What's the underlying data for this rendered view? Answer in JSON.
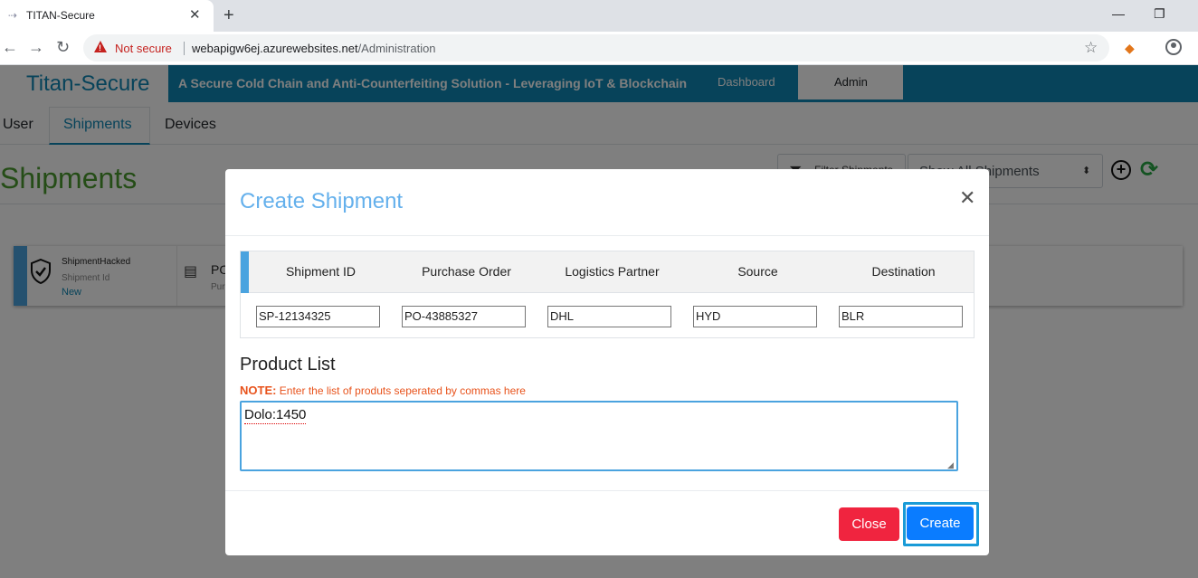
{
  "browser": {
    "tab_title": "TITAN-Secure",
    "security_label": "Not secure",
    "url_host": "webapigw6ej.azurewebsites.net",
    "url_path": "/Administration"
  },
  "app": {
    "brand": "Titan-Secure",
    "tagline": "A Secure Cold Chain and Anti-Counterfeiting Solution - Leveraging IoT & Blockchain",
    "nav": {
      "dashboard": "Dashboard",
      "admin": "Admin"
    },
    "subtabs": {
      "user": "User",
      "shipments": "Shipments",
      "devices": "Devices"
    },
    "page_title": "Shipments",
    "filter_label": "Filter Shipments",
    "show_select": "Show All Shipments",
    "card": {
      "name": "ShipmentHacked",
      "sub_label": "Shipment Id",
      "status": "New",
      "po_label": "PO",
      "po_sub": "Pur"
    }
  },
  "modal": {
    "title": "Create Shipment",
    "columns": [
      "Shipment ID",
      "Purchase Order",
      "Logistics Partner",
      "Source",
      "Destination"
    ],
    "values": [
      "SP-12134325",
      "PO-43885327",
      "DHL",
      "HYD",
      "BLR"
    ],
    "product_list_label": "Product List",
    "note_key": "NOTE:",
    "note_text": "Enter the list of produts seperated by commas here",
    "product_value": "Dolo:1450",
    "close_label": "Close",
    "create_label": "Create"
  },
  "colors": {
    "brand_teal": "#0f87b4",
    "title_green": "#4a9a2e",
    "modal_title_blue": "#64b0ec",
    "note_orange": "#e8531c",
    "close_red": "#f0243f",
    "create_blue": "#0a7cff"
  }
}
